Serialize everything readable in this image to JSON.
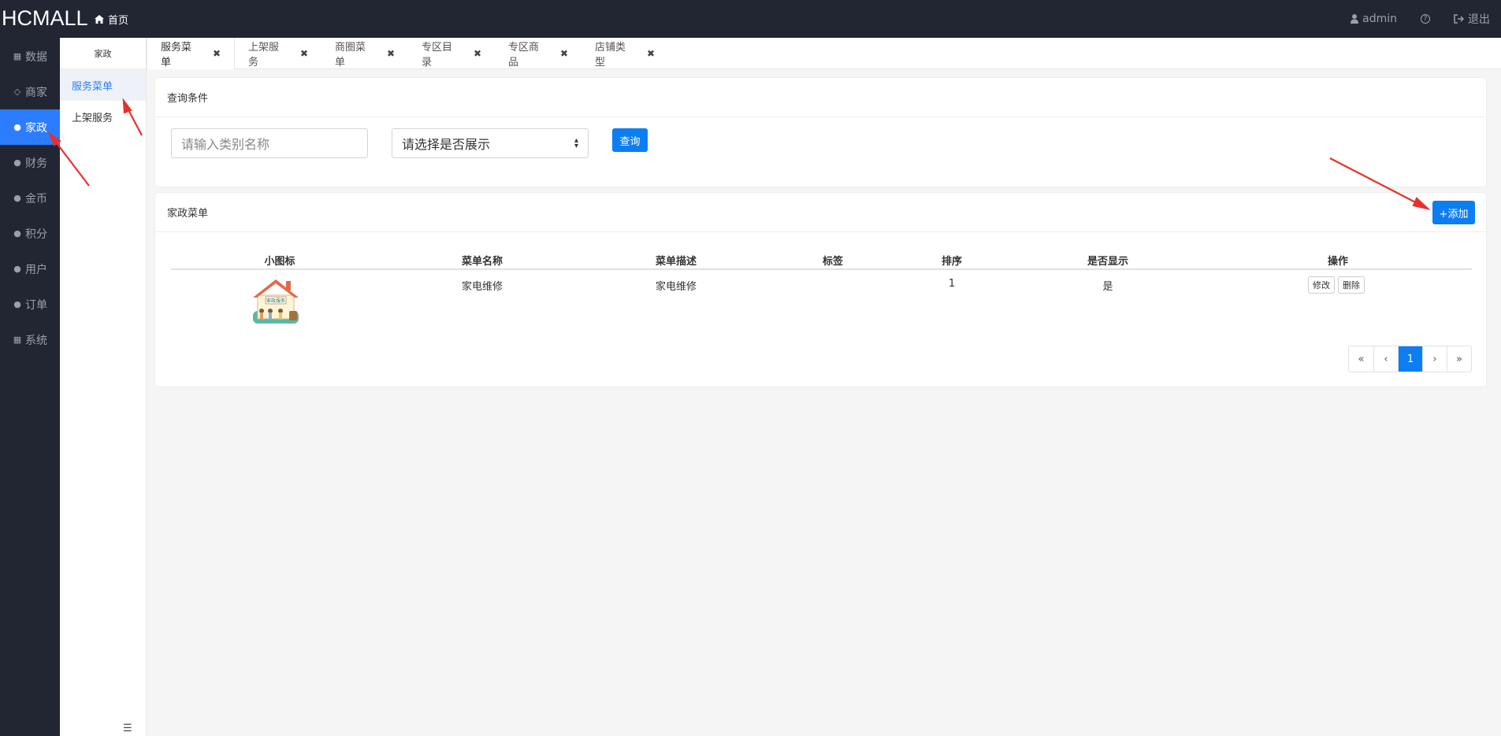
{
  "header": {
    "brand": "HCMALL",
    "home": "首页",
    "user": "admin",
    "help": "?",
    "logout": "退出"
  },
  "leftnav": {
    "items": [
      {
        "label": "数据",
        "icon": "grid-icon"
      },
      {
        "label": "商家",
        "icon": "diamond-icon"
      },
      {
        "label": "家政",
        "icon": "globe-icon"
      },
      {
        "label": "财务",
        "icon": "globe-icon"
      },
      {
        "label": "金币",
        "icon": "globe-icon"
      },
      {
        "label": "积分",
        "icon": "globe-icon"
      },
      {
        "label": "用户",
        "icon": "globe-icon"
      },
      {
        "label": "订单",
        "icon": "globe-icon"
      },
      {
        "label": "系统",
        "icon": "grid-icon"
      }
    ],
    "active": "家政"
  },
  "subnav": {
    "title": "家政",
    "items": [
      {
        "label": "服务菜单"
      },
      {
        "label": "上架服务"
      }
    ]
  },
  "tabs": [
    {
      "label": "服务菜单"
    },
    {
      "label": "上架服务"
    },
    {
      "label": "商圈菜单"
    },
    {
      "label": "专区目录"
    },
    {
      "label": "专区商品"
    },
    {
      "label": "店铺类型"
    }
  ],
  "query": {
    "title": "查询条件",
    "name_placeholder": "请输入类别名称",
    "select_value": "请选择是否展示",
    "search_button": "查询"
  },
  "list": {
    "title": "家政菜单",
    "add_button": "+添加",
    "columns": [
      "小图标",
      "菜单名称",
      "菜单描述",
      "标签",
      "排序",
      "是否显示",
      "操作"
    ],
    "rows": [
      {
        "icon_text": "家政服务",
        "name": "家电维修",
        "description": "家电维修",
        "tag": "",
        "sort": "1",
        "visible": "是",
        "edit": "修改",
        "delete": "删除"
      }
    ],
    "pagination": {
      "first": "«",
      "prev": "‹",
      "current": "1",
      "next": "›",
      "last": "»"
    }
  },
  "colors": {
    "topbar": "#222633",
    "accent": "#2b7cff",
    "button": "#0d7ef2",
    "annotation": "#e8302c"
  }
}
